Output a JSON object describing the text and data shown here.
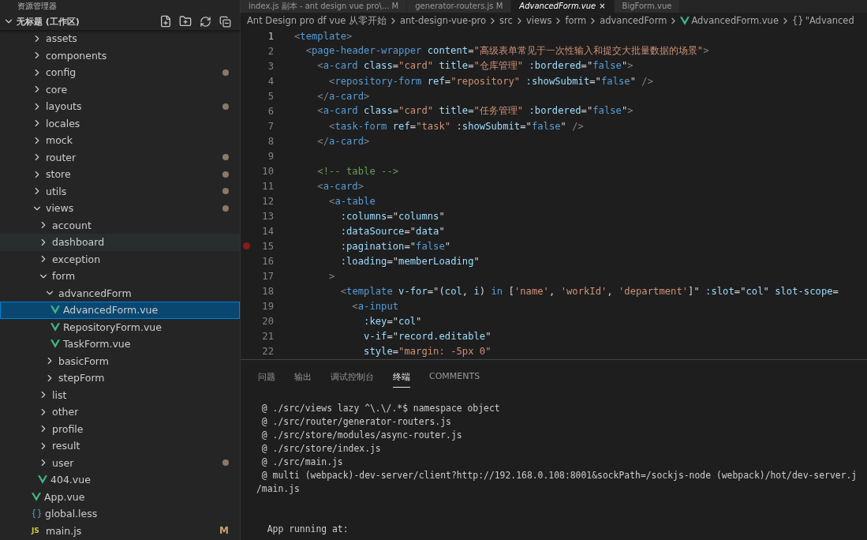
{
  "sidebar": {
    "title": "资源管理器",
    "workspace": "无标题 (工作区)",
    "expanded": true,
    "tree": [
      {
        "label": "assets",
        "kind": "folder",
        "expanded": false,
        "modified": false
      },
      {
        "label": "components",
        "kind": "folder",
        "expanded": false,
        "modified": false
      },
      {
        "label": "config",
        "kind": "folder",
        "expanded": false,
        "modified": true
      },
      {
        "label": "core",
        "kind": "folder",
        "expanded": false,
        "modified": false
      },
      {
        "label": "layouts",
        "kind": "folder",
        "expanded": false,
        "modified": true
      },
      {
        "label": "locales",
        "kind": "folder",
        "expanded": false,
        "modified": false
      },
      {
        "label": "mock",
        "kind": "folder",
        "expanded": false,
        "modified": false
      },
      {
        "label": "router",
        "kind": "folder",
        "expanded": false,
        "modified": true
      },
      {
        "label": "store",
        "kind": "folder",
        "expanded": false,
        "modified": true
      },
      {
        "label": "utils",
        "kind": "folder",
        "expanded": false,
        "modified": true
      },
      {
        "label": "views",
        "kind": "folder",
        "expanded": true,
        "modified": true,
        "children": [
          {
            "label": "account",
            "kind": "folder",
            "expanded": false,
            "modified": false
          },
          {
            "label": "dashboard",
            "kind": "folder",
            "expanded": false,
            "modified": false,
            "hovered": true
          },
          {
            "label": "exception",
            "kind": "folder",
            "expanded": false,
            "modified": false
          },
          {
            "label": "form",
            "kind": "folder",
            "expanded": true,
            "modified": false,
            "children": [
              {
                "label": "advancedForm",
                "kind": "folder",
                "expanded": true,
                "modified": false,
                "children": [
                  {
                    "label": "AdvancedForm.vue",
                    "kind": "vue",
                    "selected": true,
                    "modified": false
                  },
                  {
                    "label": "RepositoryForm.vue",
                    "kind": "vue",
                    "selected": false,
                    "modified": false
                  },
                  {
                    "label": "TaskForm.vue",
                    "kind": "vue",
                    "selected": false,
                    "modified": false
                  }
                ]
              },
              {
                "label": "basicForm",
                "kind": "folder",
                "expanded": false,
                "modified": false
              },
              {
                "label": "stepForm",
                "kind": "folder",
                "expanded": false,
                "modified": false
              }
            ]
          },
          {
            "label": "list",
            "kind": "folder",
            "expanded": false,
            "modified": false
          },
          {
            "label": "other",
            "kind": "folder",
            "expanded": false,
            "modified": false
          },
          {
            "label": "profile",
            "kind": "folder",
            "expanded": false,
            "modified": false
          },
          {
            "label": "result",
            "kind": "folder",
            "expanded": false,
            "modified": false
          },
          {
            "label": "user",
            "kind": "folder",
            "expanded": false,
            "modified": true
          },
          {
            "label": "404.vue",
            "kind": "vue",
            "selected": false,
            "modified": false
          }
        ]
      },
      {
        "label": "App.vue",
        "kind": "vue",
        "selected": false,
        "modified": false
      },
      {
        "label": "global.less",
        "kind": "less",
        "selected": false,
        "modified": false
      },
      {
        "label": "main.js",
        "kind": "js",
        "selected": false,
        "modified": false,
        "badge": "JS",
        "status": "M"
      }
    ]
  },
  "editor_tabs": [
    {
      "label": "index.js 副本 - ant design vue pro\\... M",
      "selected": false
    },
    {
      "label": "generator-routers.js M",
      "selected": false
    },
    {
      "label": "AdvancedForm.vue",
      "selected": true,
      "close": "×"
    },
    {
      "label": "BigForm.vue",
      "selected": false
    }
  ],
  "breadcrumbs": [
    {
      "label": "Ant Design pro df vue 从零开始",
      "kind": "folder"
    },
    {
      "label": "ant-design-vue-pro",
      "kind": "folder"
    },
    {
      "label": "src",
      "kind": "folder"
    },
    {
      "label": "views",
      "kind": "folder"
    },
    {
      "label": "form",
      "kind": "folder"
    },
    {
      "label": "advancedForm",
      "kind": "folder"
    },
    {
      "label": "AdvancedForm.vue",
      "kind": "vue"
    },
    {
      "label": "\"Advanced",
      "kind": "symbol",
      "badge": "{}"
    }
  ],
  "code": [
    {
      "number": "1",
      "current": true,
      "breakpoint": false,
      "tokens": [
        {
          "kind": "p",
          "text": "<"
        },
        {
          "kind": "tag",
          "text": "template"
        },
        {
          "kind": "p",
          "text": ">"
        }
      ]
    },
    {
      "number": "2",
      "current": false,
      "breakpoint": false,
      "tokens": [
        {
          "kind": "p",
          "text": "  <"
        },
        {
          "kind": "tag",
          "text": "page-header-wrapper"
        },
        {
          "kind": "attr",
          "text": " content"
        },
        {
          "kind": "eq",
          "text": "="
        },
        {
          "kind": "str",
          "text": "\"高级表单常见于一次性输入和提交大批量数据的场景\""
        },
        {
          "kind": "p",
          "text": ">"
        }
      ]
    },
    {
      "number": "3",
      "current": false,
      "breakpoint": false,
      "tokens": [
        {
          "kind": "p",
          "text": "    <"
        },
        {
          "kind": "tag",
          "text": "a-card"
        },
        {
          "kind": "attr",
          "text": " class"
        },
        {
          "kind": "eq",
          "text": "="
        },
        {
          "kind": "str",
          "text": "\"card\""
        },
        {
          "kind": "attr",
          "text": " title"
        },
        {
          "kind": "eq",
          "text": "="
        },
        {
          "kind": "str",
          "text": "\"仓库管理\""
        },
        {
          "kind": "attr",
          "text": " :bordered"
        },
        {
          "kind": "eq",
          "text": "=\""
        },
        {
          "kind": "kw",
          "text": "false"
        },
        {
          "kind": "eq",
          "text": "\""
        },
        {
          "kind": "p",
          "text": ">"
        }
      ]
    },
    {
      "number": "4",
      "current": false,
      "breakpoint": false,
      "tokens": [
        {
          "kind": "p",
          "text": "      <"
        },
        {
          "kind": "tag",
          "text": "repository-form"
        },
        {
          "kind": "attr",
          "text": " ref"
        },
        {
          "kind": "eq",
          "text": "="
        },
        {
          "kind": "str",
          "text": "\"repository\""
        },
        {
          "kind": "attr",
          "text": " :showSubmit"
        },
        {
          "kind": "eq",
          "text": "=\""
        },
        {
          "kind": "kw",
          "text": "false"
        },
        {
          "kind": "eq",
          "text": "\""
        },
        {
          "kind": "p",
          "text": " />"
        }
      ]
    },
    {
      "number": "5",
      "current": false,
      "breakpoint": false,
      "tokens": [
        {
          "kind": "p",
          "text": "    </"
        },
        {
          "kind": "tag",
          "text": "a-card"
        },
        {
          "kind": "p",
          "text": ">"
        }
      ]
    },
    {
      "number": "6",
      "current": false,
      "breakpoint": false,
      "tokens": [
        {
          "kind": "p",
          "text": "    <"
        },
        {
          "kind": "tag",
          "text": "a-card"
        },
        {
          "kind": "attr",
          "text": " class"
        },
        {
          "kind": "eq",
          "text": "="
        },
        {
          "kind": "str",
          "text": "\"card\""
        },
        {
          "kind": "attr",
          "text": " title"
        },
        {
          "kind": "eq",
          "text": "="
        },
        {
          "kind": "str",
          "text": "\"任务管理\""
        },
        {
          "kind": "attr",
          "text": " :bordered"
        },
        {
          "kind": "eq",
          "text": "=\""
        },
        {
          "kind": "kw",
          "text": "false"
        },
        {
          "kind": "eq",
          "text": "\""
        },
        {
          "kind": "p",
          "text": ">"
        }
      ]
    },
    {
      "number": "7",
      "current": false,
      "breakpoint": false,
      "tokens": [
        {
          "kind": "p",
          "text": "      <"
        },
        {
          "kind": "tag",
          "text": "task-form"
        },
        {
          "kind": "attr",
          "text": " ref"
        },
        {
          "kind": "eq",
          "text": "="
        },
        {
          "kind": "str",
          "text": "\"task\""
        },
        {
          "kind": "attr",
          "text": " :showSubmit"
        },
        {
          "kind": "eq",
          "text": "=\""
        },
        {
          "kind": "kw",
          "text": "false"
        },
        {
          "kind": "eq",
          "text": "\""
        },
        {
          "kind": "p",
          "text": " />"
        }
      ]
    },
    {
      "number": "8",
      "current": false,
      "breakpoint": false,
      "tokens": [
        {
          "kind": "p",
          "text": "    </"
        },
        {
          "kind": "tag",
          "text": "a-card"
        },
        {
          "kind": "p",
          "text": ">"
        }
      ]
    },
    {
      "number": "9",
      "current": false,
      "breakpoint": false
    },
    {
      "number": "10",
      "current": false,
      "breakpoint": false,
      "tokens": [
        {
          "kind": "com",
          "text": "    <!-- table -->"
        }
      ]
    },
    {
      "number": "11",
      "current": false,
      "breakpoint": false,
      "tokens": [
        {
          "kind": "p",
          "text": "    <"
        },
        {
          "kind": "tag",
          "text": "a-card"
        },
        {
          "kind": "p",
          "text": ">"
        }
      ]
    },
    {
      "number": "12",
      "current": false,
      "breakpoint": false,
      "tokens": [
        {
          "kind": "p",
          "text": "      <"
        },
        {
          "kind": "tag",
          "text": "a-table"
        }
      ]
    },
    {
      "number": "13",
      "current": false,
      "breakpoint": false,
      "tokens": [
        {
          "kind": "attr",
          "text": "        :columns"
        },
        {
          "kind": "eq",
          "text": "=\""
        },
        {
          "kind": "var",
          "text": "columns"
        },
        {
          "kind": "eq",
          "text": "\""
        }
      ]
    },
    {
      "number": "14",
      "current": false,
      "breakpoint": false,
      "tokens": [
        {
          "kind": "attr",
          "text": "        :dataSource"
        },
        {
          "kind": "eq",
          "text": "=\""
        },
        {
          "kind": "var",
          "text": "data"
        },
        {
          "kind": "eq",
          "text": "\""
        }
      ]
    },
    {
      "number": "15",
      "current": false,
      "breakpoint": true,
      "tokens": [
        {
          "kind": "attr",
          "text": "        :pagination"
        },
        {
          "kind": "eq",
          "text": "=\""
        },
        {
          "kind": "kw",
          "text": "false"
        },
        {
          "kind": "eq",
          "text": "\""
        }
      ]
    },
    {
      "number": "16",
      "current": false,
      "breakpoint": false,
      "tokens": [
        {
          "kind": "attr",
          "text": "        :loading"
        },
        {
          "kind": "eq",
          "text": "=\""
        },
        {
          "kind": "var",
          "text": "memberLoading"
        },
        {
          "kind": "eq",
          "text": "\""
        }
      ]
    },
    {
      "number": "17",
      "current": false,
      "breakpoint": false,
      "tokens": [
        {
          "kind": "p",
          "text": "      >"
        }
      ]
    },
    {
      "number": "18",
      "current": false,
      "breakpoint": false,
      "tokens": [
        {
          "kind": "p",
          "text": "        <"
        },
        {
          "kind": "tag",
          "text": "template"
        },
        {
          "kind": "attr",
          "text": " v-for"
        },
        {
          "kind": "eq",
          "text": "=\"("
        },
        {
          "kind": "var",
          "text": "col"
        },
        {
          "kind": "eq",
          "text": ", "
        },
        {
          "kind": "var",
          "text": "i"
        },
        {
          "kind": "eq",
          "text": ") "
        },
        {
          "kind": "kw",
          "text": "in"
        },
        {
          "kind": "eq",
          "text": " ["
        },
        {
          "kind": "str",
          "text": "'name'"
        },
        {
          "kind": "eq",
          "text": ", "
        },
        {
          "kind": "str",
          "text": "'workId'"
        },
        {
          "kind": "eq",
          "text": ", "
        },
        {
          "kind": "str",
          "text": "'department'"
        },
        {
          "kind": "eq",
          "text": "]\""
        },
        {
          "kind": "attr",
          "text": " :slot"
        },
        {
          "kind": "eq",
          "text": "=\""
        },
        {
          "kind": "var",
          "text": "col"
        },
        {
          "kind": "eq",
          "text": "\""
        },
        {
          "kind": "attr",
          "text": " slot-scope"
        },
        {
          "kind": "eq",
          "text": "="
        }
      ]
    },
    {
      "number": "19",
      "current": false,
      "breakpoint": false,
      "tokens": [
        {
          "kind": "p",
          "text": "          <"
        },
        {
          "kind": "tag",
          "text": "a-input"
        }
      ]
    },
    {
      "number": "20",
      "current": false,
      "breakpoint": false,
      "tokens": [
        {
          "kind": "attr",
          "text": "            :key"
        },
        {
          "kind": "eq",
          "text": "=\""
        },
        {
          "kind": "var",
          "text": "col"
        },
        {
          "kind": "eq",
          "text": "\""
        }
      ]
    },
    {
      "number": "21",
      "current": false,
      "breakpoint": false,
      "tokens": [
        {
          "kind": "attr",
          "text": "            v-if"
        },
        {
          "kind": "eq",
          "text": "=\""
        },
        {
          "kind": "var",
          "text": "record.editable"
        },
        {
          "kind": "eq",
          "text": "\""
        }
      ]
    },
    {
      "number": "22",
      "current": false,
      "breakpoint": false,
      "tokens": [
        {
          "kind": "attr",
          "text": "            style"
        },
        {
          "kind": "eq",
          "text": "="
        },
        {
          "kind": "str",
          "text": "\"margin: -5px 0\""
        }
      ]
    }
  ],
  "panel_tabs": [
    {
      "label": "问题",
      "selected": false
    },
    {
      "label": "输出",
      "selected": false
    },
    {
      "label": "调试控制台",
      "selected": false
    },
    {
      "label": "终端",
      "selected": true
    },
    {
      "label": "COMMENTS",
      "selected": false
    }
  ],
  "terminal": [
    {
      "text": " @ ./src/views lazy ^\\.\\/.*$ namespace object",
      "kind": "line"
    },
    {
      "text": " @ ./src/router/generator-routers.js",
      "kind": "line"
    },
    {
      "text": " @ ./src/store/modules/async-router.js",
      "kind": "line"
    },
    {
      "text": " @ ./src/store/index.js",
      "kind": "line"
    },
    {
      "text": " @ ./src/main.js",
      "kind": "line"
    },
    {
      "text": " @ multi (webpack)-dev-server/client?http://192.168.0.108:8001&sockPath=/sockjs-node (webpack)/hot/dev-server.j",
      "kind": "line"
    },
    {
      "text": "/main.js",
      "kind": "line"
    },
    {
      "text": "  App running at:",
      "kind": "section"
    }
  ]
}
